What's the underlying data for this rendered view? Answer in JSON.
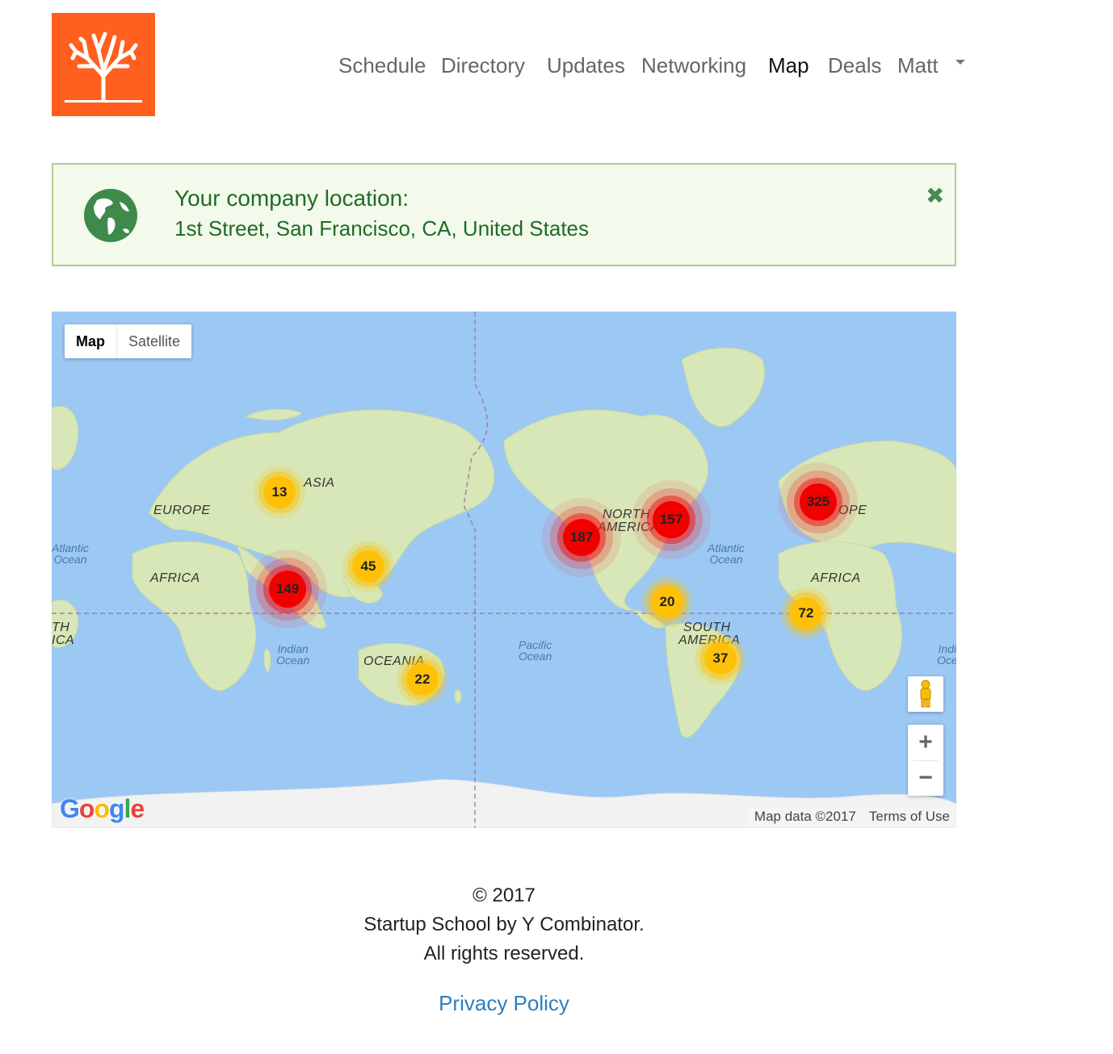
{
  "nav": {
    "items": [
      {
        "label": "Schedule",
        "active": false
      },
      {
        "label": "Directory",
        "active": false
      },
      {
        "label": "Updates",
        "active": false
      },
      {
        "label": "Networking",
        "active": false
      },
      {
        "label": "Map",
        "active": true
      },
      {
        "label": "Deals",
        "active": false
      },
      {
        "label": "Matt",
        "active": false
      }
    ]
  },
  "alert": {
    "title": "Your company location:",
    "body": "1st Street, San Francisco, CA, United States",
    "close": "✖"
  },
  "map": {
    "type_options": [
      "Map",
      "Satellite"
    ],
    "selected_type": "Map",
    "clusters": [
      {
        "count": "13",
        "level": "yellow"
      },
      {
        "count": "45",
        "level": "yellow"
      },
      {
        "count": "149",
        "level": "red"
      },
      {
        "count": "22",
        "level": "yellow"
      },
      {
        "count": "187",
        "level": "red"
      },
      {
        "count": "157",
        "level": "red"
      },
      {
        "count": "20",
        "level": "yellow"
      },
      {
        "count": "37",
        "level": "yellow"
      },
      {
        "count": "325",
        "level": "red"
      },
      {
        "count": "72",
        "level": "yellow"
      }
    ],
    "region_labels": [
      "ASIA",
      "EUROPE",
      "AFRICA",
      "OCEANIA",
      "NORTH",
      "AMERICA",
      "SOUTH",
      "AMERICA",
      "OPE",
      "AFRICA",
      "TH",
      "ICA"
    ],
    "ocean_labels": [
      "Atlantic\nOcean",
      "Indian\nOcean",
      "Pacific\nOcean",
      "Atlantic\nOcean",
      "Indi\nOce"
    ],
    "zoom_in": "+",
    "zoom_out": "−",
    "google_logo": "Google",
    "map_data": "Map data ©2017",
    "terms": "Terms of Use",
    "colors": {
      "water": "#9cc8f4",
      "land": "#d6e6b4",
      "yellow_cluster": "#ffc107",
      "red_cluster": "#f20000"
    }
  },
  "footer": {
    "copyright": "© 2017",
    "company": "Startup School by Y Combinator.",
    "rights": "All rights reserved.",
    "privacy": "Privacy Policy"
  },
  "colors": {
    "logo_bg": "#ff5f1f",
    "alert_bg": "#f3faec",
    "alert_text": "#1f6b26",
    "link": "#2a7fc1"
  }
}
